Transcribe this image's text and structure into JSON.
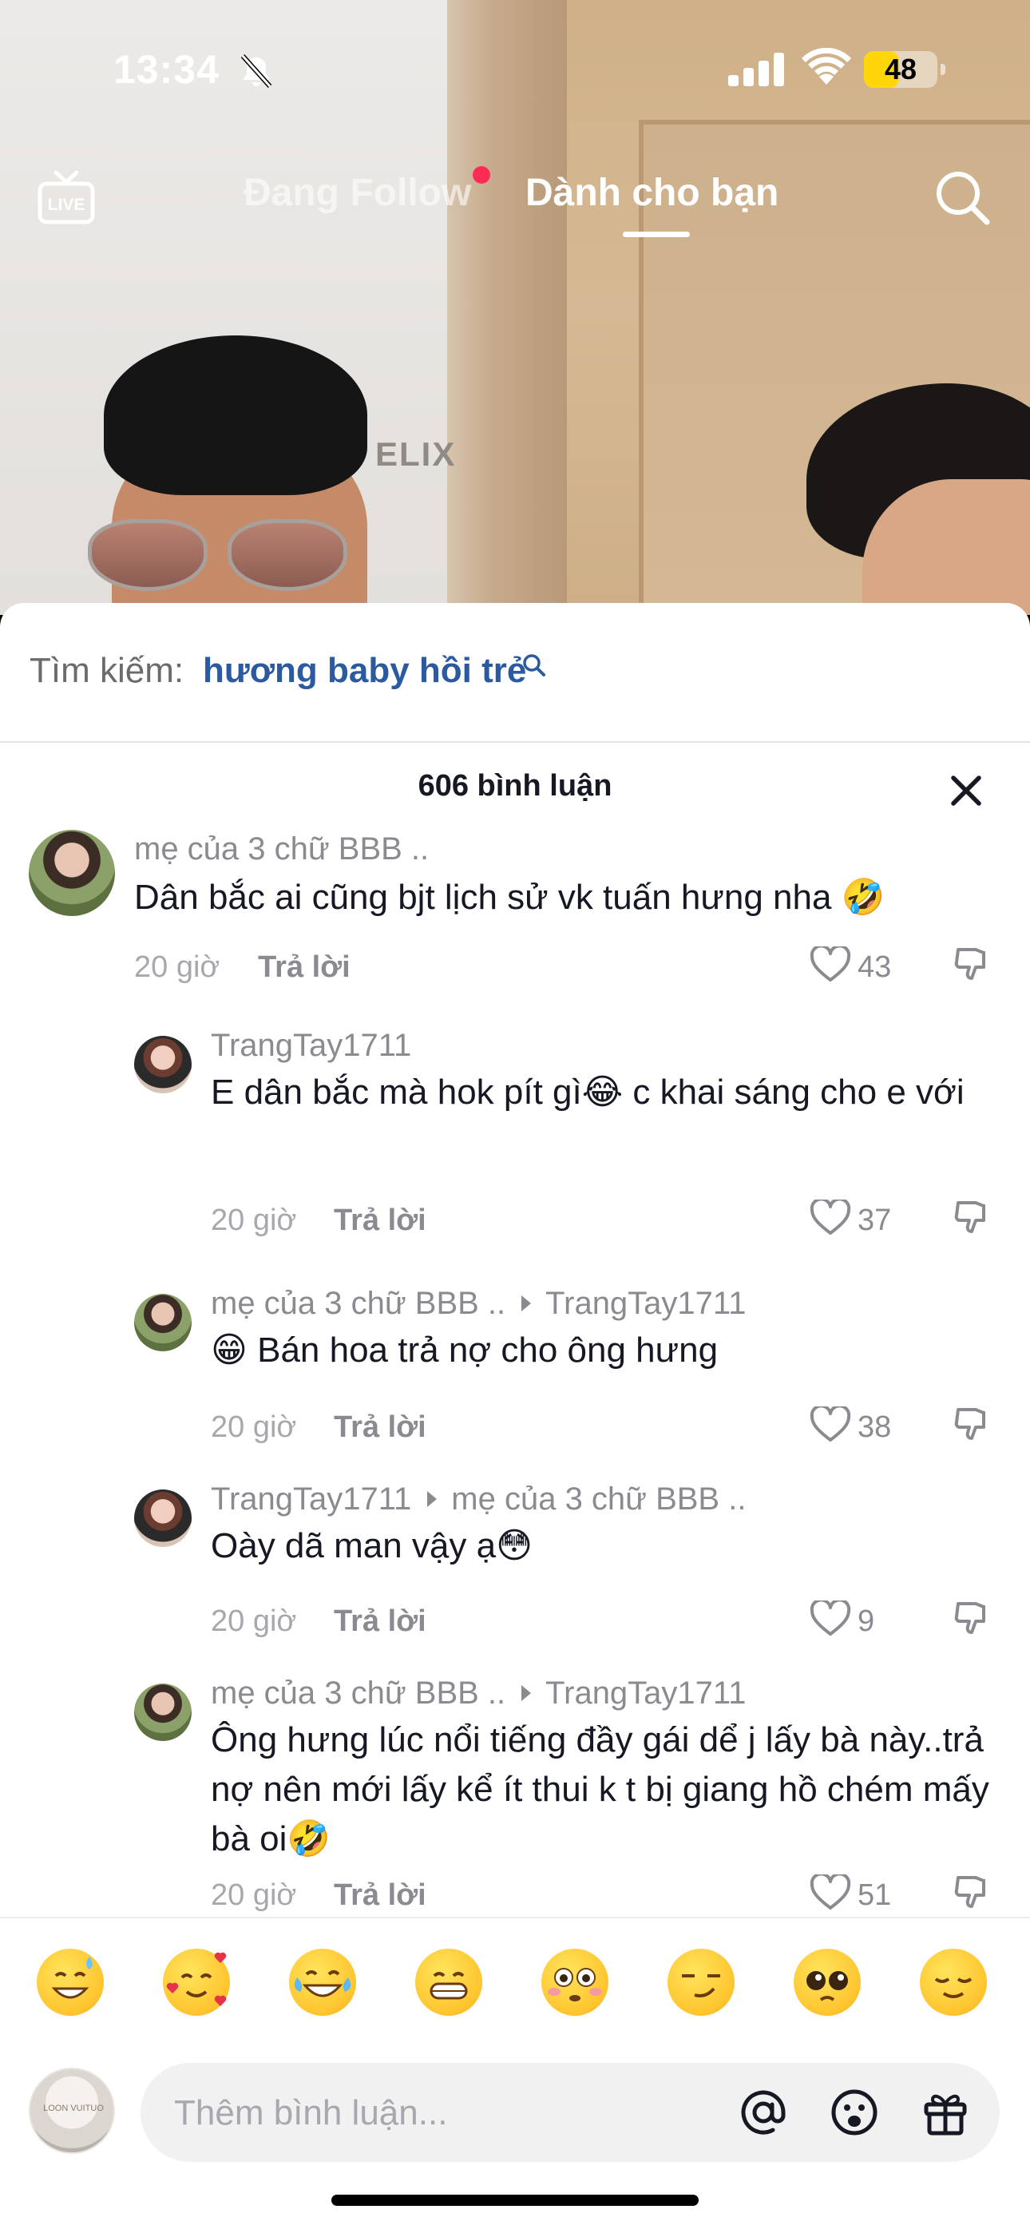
{
  "status_bar": {
    "time": "13:34",
    "battery": "48",
    "battery_level": 0.48,
    "icons": [
      "bell-slash-icon",
      "cellular-signal-icon",
      "wifi-icon",
      "battery-icon"
    ]
  },
  "video": {
    "sign_text": "ELIX"
  },
  "top_nav": {
    "live_label": "LIVE",
    "tab_following": "Đang Follow",
    "tab_for_you": "Dành cho bạn",
    "active_tab": "for_you",
    "icons": [
      "live-icon",
      "search-icon"
    ]
  },
  "search_suggestion": {
    "label": "Tìm kiếm:",
    "term": "hương baby hồi trẻ"
  },
  "comment_sheet": {
    "count_label": "606 bình luận",
    "close_icon": "close-icon",
    "reply_label": "Trả lời",
    "comments": [
      {
        "user": "mẹ của 3 chữ BBB ..",
        "reply_to": "",
        "text": "Dân bắc ai cũng bjt lịch sử vk tuấn hưng nha 🤣",
        "time": "20 giờ",
        "likes": "43",
        "level": 0
      },
      {
        "user": "TrangTay1711",
        "reply_to": "",
        "text": "E dân bắc mà hok pít gì😂 c khai sáng cho e với",
        "time": "20 giờ",
        "likes": "37",
        "level": 1
      },
      {
        "user": "mẹ của 3 chữ BBB ..",
        "reply_to": "TrangTay1711",
        "text": "😁 Bán hoa trả nợ cho ông hưng",
        "time": "20 giờ",
        "likes": "38",
        "level": 1
      },
      {
        "user": "TrangTay1711",
        "reply_to": "mẹ của 3 chữ BBB ..",
        "text": "Oày dã man vậy ạ😳",
        "time": "20 giờ",
        "likes": "9",
        "level": 1
      },
      {
        "user": "mẹ của 3 chữ BBB ..",
        "reply_to": "TrangTay1711",
        "text": "Ông hưng lúc nổi tiếng đầy gái dể j lấy bà này..trả nợ nên mới lấy kể ít thui k t bị giang hồ chém mấy bà oi🤣",
        "time": "20 giờ",
        "likes": "51",
        "level": 1
      }
    ]
  },
  "emoji_bar": {
    "emojis": [
      "😅",
      "🥰",
      "😂",
      "😁",
      "😳",
      "😏",
      "🥺",
      "😌"
    ]
  },
  "input_bar": {
    "placeholder": "Thêm bình luận...",
    "icons": [
      "at-mention-icon",
      "emoji-icon",
      "gift-icon"
    ],
    "avatar_text": "LOON VUITUO"
  }
}
